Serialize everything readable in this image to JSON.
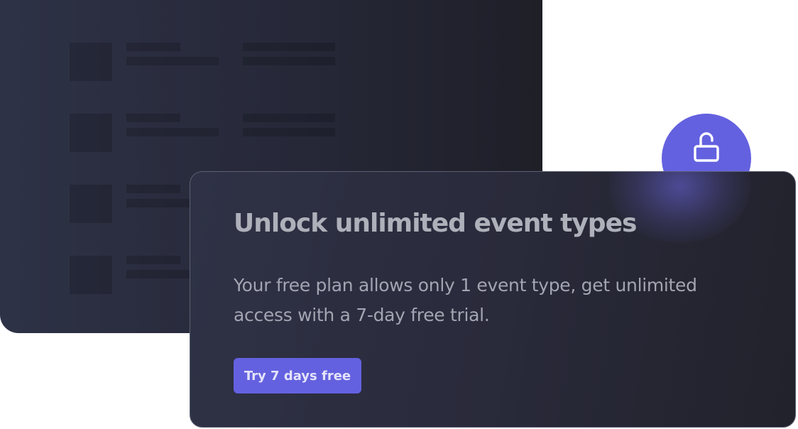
{
  "promo": {
    "title": "Unlock unlimited event types",
    "description": "Your free plan allows only 1 event type, get unlimited access with a 7-day free trial.",
    "cta_label": "Try 7 days free"
  },
  "icons": {
    "lock": "unlock-icon"
  },
  "colors": {
    "accent": "#6461e0",
    "card_dark": "#2a2b3c",
    "title_text": "#aeb0ba",
    "body_text": "#a3a5b2"
  }
}
